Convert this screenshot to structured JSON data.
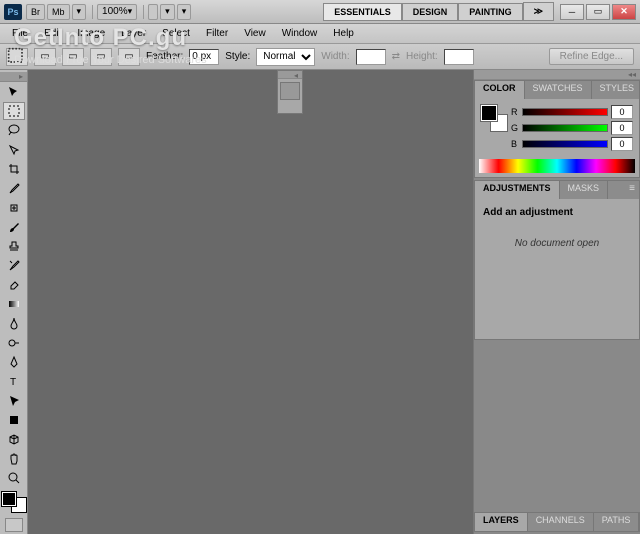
{
  "watermark": {
    "title": "GetInto PC.gu",
    "subtitle": "Download Free Your Desired Softwares"
  },
  "titlebar": {
    "logo": "Ps",
    "bridge": "Br",
    "minibridge": "Mb",
    "zoom": "100%",
    "workspaces": {
      "essentials": "ESSENTIALS",
      "design": "DESIGN",
      "painting": "PAINTING"
    },
    "expand": "≫"
  },
  "menu": {
    "file": "File",
    "edit": "Edit",
    "image": "Image",
    "layer": "Layer",
    "select": "Select",
    "filter": "Filter",
    "view": "View",
    "window": "Window",
    "help": "Help"
  },
  "options": {
    "feather_label": "Feather:",
    "feather_value": "0 px",
    "style_label": "Style:",
    "style_value": "Normal",
    "width_label": "Width:",
    "height_label": "Height:",
    "refine": "Refine Edge..."
  },
  "panels": {
    "color": {
      "tab_color": "COLOR",
      "tab_swatches": "SWATCHES",
      "tab_styles": "STYLES",
      "r": "R",
      "g": "G",
      "b": "B",
      "r_val": "0",
      "g_val": "0",
      "b_val": "0"
    },
    "adjustments": {
      "tab_adj": "ADJUSTMENTS",
      "tab_masks": "MASKS",
      "title": "Add an adjustment",
      "msg": "No document open"
    },
    "layers": {
      "tab_layers": "LAYERS",
      "tab_channels": "CHANNELS",
      "tab_paths": "PATHS"
    }
  }
}
